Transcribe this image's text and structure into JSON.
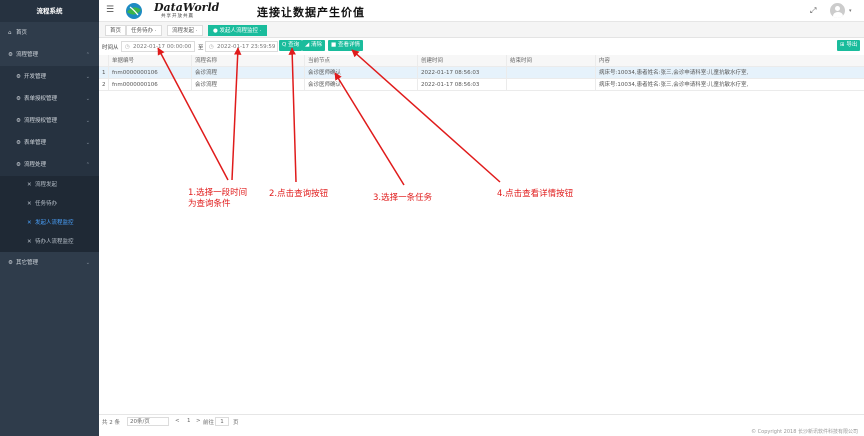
{
  "sidebar": {
    "title": "流程系统",
    "items": [
      {
        "icon": "home-icon",
        "glyph": "⌂",
        "label": "首页"
      },
      {
        "icon": "gear-icon",
        "glyph": "⚙",
        "label": "流程管理"
      },
      {
        "icon": "gear-icon",
        "glyph": "⚙",
        "label": "开发管理"
      },
      {
        "icon": "gear-icon",
        "glyph": "⚙",
        "label": "表单授权管理"
      },
      {
        "icon": "gear-icon",
        "glyph": "⚙",
        "label": "流程授权管理"
      },
      {
        "icon": "gear-icon",
        "glyph": "⚙",
        "label": "表单管理"
      },
      {
        "icon": "gear-icon",
        "glyph": "⚙",
        "label": "流程处理"
      },
      {
        "icon": "tools-icon",
        "glyph": "✕",
        "label": "流程发起"
      },
      {
        "icon": "tools-icon",
        "glyph": "✕",
        "label": "任务待办"
      },
      {
        "icon": "tools-icon",
        "glyph": "✕",
        "label": "发起人流程监控"
      },
      {
        "icon": "tools-icon",
        "glyph": "✕",
        "label": "待办人流程监控"
      },
      {
        "icon": "gear-icon",
        "glyph": "⚙",
        "label": "其它管理"
      }
    ]
  },
  "header": {
    "logo_text": "DataWorld",
    "logo_sub": "共享开放共赢",
    "slogan": "连接让数据产生价值",
    "fullscreen_glyph": "⤢",
    "caret": "▾"
  },
  "tabs": [
    {
      "label": "首页"
    },
    {
      "label": "任务待办 ·"
    },
    {
      "label": "流程发起 ·"
    },
    {
      "label": "● 发起人流程监控 ·"
    }
  ],
  "toolbar": {
    "time_from_label": "时间从",
    "date_from": "2022-01-17 00:00:00",
    "to_label": "至",
    "date_to": "2022-01-17 23:59:59",
    "query_label": "Q 查询",
    "clear_label": "◢ 清除",
    "detail_label": "■ 查看详情",
    "export_label": "⊞ 导出",
    "clock": "◷"
  },
  "table": {
    "columns": [
      "",
      "单据编号",
      "流程名称",
      "当前节点",
      "创建时间",
      "结束时间",
      "内容"
    ],
    "rows": [
      [
        "1",
        "fnm0000000106",
        "会诊流程",
        "会诊医师确认",
        "2022-01-17 08:56:03",
        "",
        "病床号:10034,患者姓名:张三,会诊申请科室:儿童抗敏水疗室,"
      ],
      [
        "2",
        "fnm0000000106",
        "会诊流程",
        "会诊医师确认",
        "2022-01-17 08:56:03",
        "",
        "病床号:10034,患者姓名:张三,会诊申请科室:儿童抗敏水疗室,"
      ]
    ]
  },
  "pager": {
    "total": "共 2 条",
    "page_size": "20条/页",
    "prev": "<",
    "goto_label": "前往",
    "page": "1",
    "page_unit": "页",
    "next": ">"
  },
  "copyright": "© Copyright 2018 长沙新讯软件科技有限公司",
  "annotations": {
    "step1_line1": "1.选择一段时间",
    "step1_line2": "为查询条件",
    "step2": "2.点击查询按钮",
    "step3": "3.选择一条任务",
    "step4": "4.点击查看详情按钮"
  },
  "colors": {
    "accent": "#1abc9c",
    "sidebar": "#2f3c4b",
    "annotation": "#e01b1b",
    "link": "#4aa3ff"
  }
}
